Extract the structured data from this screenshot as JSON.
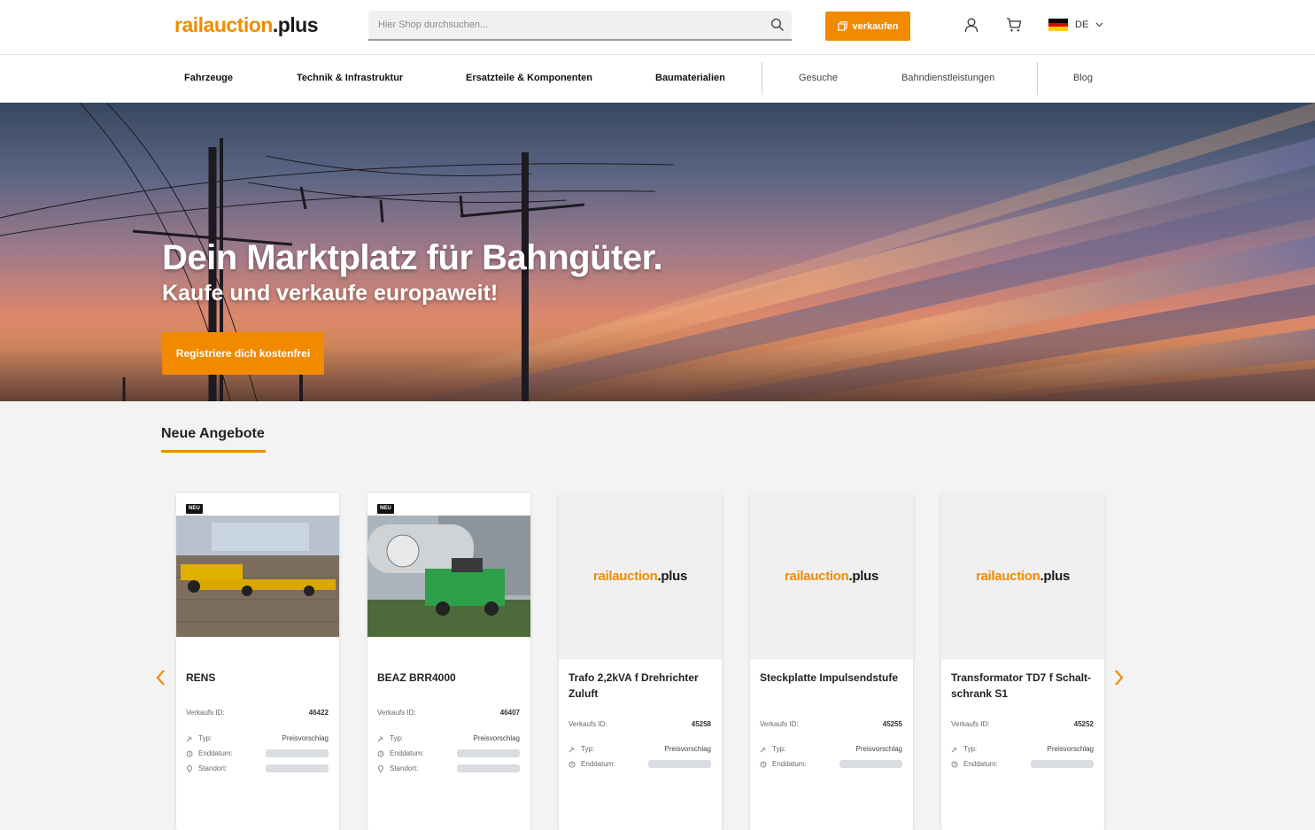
{
  "header": {
    "logo_part1": "railauction",
    "logo_part2": ".plus",
    "search_placeholder": "Hier Shop durchsuchen...",
    "sell_label": "verkaufen",
    "lang": "DE",
    "accent": "#f28a00"
  },
  "nav": {
    "items": [
      "Fahrzeuge",
      "Technik & Infrastruktur",
      "Ersatzteile & Komponenten",
      "Baumaterialien",
      "Gesuche",
      "Bahndienstleistungen",
      "Blog"
    ]
  },
  "hero": {
    "title": "Dein Marktplatz für Bahngüter.",
    "subtitle": "Kaufe und verkaufe europaweit!",
    "cta": "Registriere dich kostenfrei"
  },
  "offers": {
    "title": "Neue Angebote",
    "badge": "NEU",
    "id_label": "Verkaufs ID:",
    "type_label": "Typ:",
    "end_label": "Enddatum:",
    "location_label": "Standort:",
    "cards": [
      {
        "title": "RENS",
        "id": "46422",
        "type": "Preisvorschlag"
      },
      {
        "title": "BEAZ BRR4000",
        "id": "46407",
        "type": "Preisvorschlag"
      },
      {
        "title": "Trafo 2,2kVA f Drehrichter Zuluft",
        "id": "45258",
        "type": "Preisvorschlag"
      },
      {
        "title": "Steckplatte Impulsendstufe",
        "id": "45255",
        "type": "Preisvorschlag"
      },
      {
        "title": "Transformator TD7 f Schalt-schrank S1",
        "id": "45252",
        "type": "Preisvorschlag"
      }
    ]
  }
}
